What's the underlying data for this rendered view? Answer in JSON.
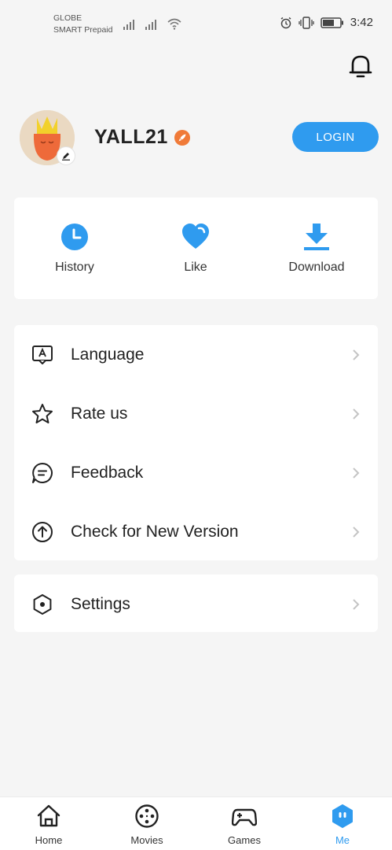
{
  "status_bar": {
    "carrier_1": "GLOBE",
    "carrier_2": "SMART Prepaid",
    "time": "3:42"
  },
  "profile": {
    "username": "YALL21",
    "login_label": "LOGIN"
  },
  "quick_actions": [
    {
      "label": "History",
      "icon": "clock-icon"
    },
    {
      "label": "Like",
      "icon": "heart-icon"
    },
    {
      "label": "Download",
      "icon": "download-icon"
    }
  ],
  "menu": [
    {
      "label": "Language",
      "icon": "language-icon"
    },
    {
      "label": "Rate us",
      "icon": "star-icon"
    },
    {
      "label": "Feedback",
      "icon": "feedback-icon"
    },
    {
      "label": "Check for New Version",
      "icon": "upgrade-icon"
    }
  ],
  "menu2": [
    {
      "label": "Settings",
      "icon": "settings-icon"
    }
  ],
  "tabs": [
    {
      "label": "Home",
      "icon": "home-icon"
    },
    {
      "label": "Movies",
      "icon": "film-reel-icon"
    },
    {
      "label": "Games",
      "icon": "gamepad-icon"
    },
    {
      "label": "Me",
      "icon": "me-icon",
      "active": true
    }
  ],
  "colors": {
    "accent": "#2f9bef",
    "badge": "#f07a38",
    "background": "#f5f5f5"
  }
}
